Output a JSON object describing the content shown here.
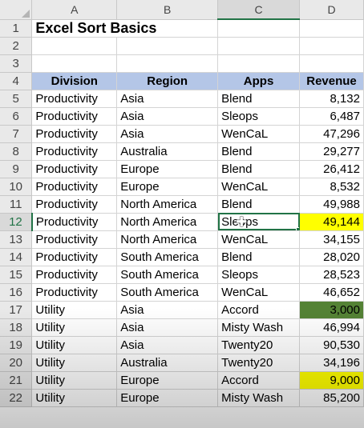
{
  "columns": [
    "A",
    "B",
    "C",
    "D"
  ],
  "selected_column": "C",
  "title": "Excel Sort Basics",
  "headers": [
    "Division",
    "Region",
    "Apps",
    "Revenue"
  ],
  "row_numbers": [
    "1",
    "2",
    "3",
    "4",
    "5",
    "6",
    "7",
    "8",
    "9",
    "10",
    "11",
    "12",
    "13",
    "14",
    "15",
    "16",
    "17",
    "18",
    "19",
    "20",
    "21",
    "22"
  ],
  "rows": [
    {
      "row": "5",
      "division": "Productivity",
      "region": "Asia",
      "app": "Blend",
      "revenue": "8,132"
    },
    {
      "row": "6",
      "division": "Productivity",
      "region": "Asia",
      "app": "Sleops",
      "revenue": "6,487"
    },
    {
      "row": "7",
      "division": "Productivity",
      "region": "Asia",
      "app": "WenCaL",
      "revenue": "47,296"
    },
    {
      "row": "8",
      "division": "Productivity",
      "region": "Australia",
      "app": "Blend",
      "revenue": "29,277"
    },
    {
      "row": "9",
      "division": "Productivity",
      "region": "Europe",
      "app": "Blend",
      "revenue": "26,412"
    },
    {
      "row": "10",
      "division": "Productivity",
      "region": "Europe",
      "app": "WenCaL",
      "revenue": "8,532"
    },
    {
      "row": "11",
      "division": "Productivity",
      "region": "North America",
      "app": "Blend",
      "revenue": "49,988"
    },
    {
      "row": "12",
      "division": "Productivity",
      "region": "North America",
      "app": "Sleops",
      "revenue": "49,144",
      "highlight": "yellow",
      "active": true
    },
    {
      "row": "13",
      "division": "Productivity",
      "region": "North America",
      "app": "WenCaL",
      "revenue": "34,155"
    },
    {
      "row": "14",
      "division": "Productivity",
      "region": "South America",
      "app": "Blend",
      "revenue": "28,020"
    },
    {
      "row": "15",
      "division": "Productivity",
      "region": "South America",
      "app": "Sleops",
      "revenue": "28,523"
    },
    {
      "row": "16",
      "division": "Productivity",
      "region": "South America",
      "app": "WenCaL",
      "revenue": "46,652"
    },
    {
      "row": "17",
      "division": "Utility",
      "region": "Asia",
      "app": "Accord",
      "revenue": "3,000",
      "highlight": "green"
    },
    {
      "row": "18",
      "division": "Utility",
      "region": "Asia",
      "app": "Misty Wash",
      "revenue": "46,994"
    },
    {
      "row": "19",
      "division": "Utility",
      "region": "Asia",
      "app": "Twenty20",
      "revenue": "90,530"
    },
    {
      "row": "20",
      "division": "Utility",
      "region": "Australia",
      "app": "Twenty20",
      "revenue": "34,196"
    },
    {
      "row": "21",
      "division": "Utility",
      "region": "Europe",
      "app": "Accord",
      "revenue": "9,000",
      "highlight": "yellow"
    },
    {
      "row": "22",
      "division": "Utility",
      "region": "Europe",
      "app": "Misty Wash",
      "revenue": "85,200"
    }
  ],
  "active_cell": "C12",
  "cursor_icon": "move-cross-icon",
  "colors": {
    "header_fill": "#b4c6e7",
    "highlight_yellow": "#ffff00",
    "highlight_green": "#548235",
    "selection": "#217346"
  }
}
